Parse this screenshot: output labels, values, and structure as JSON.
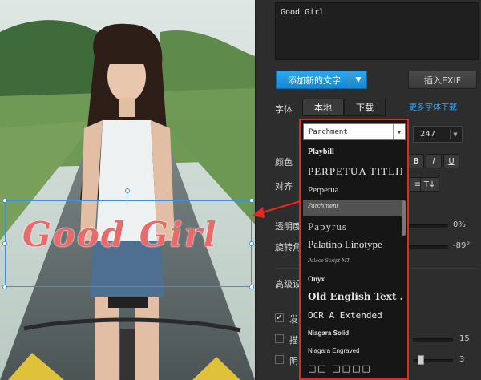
{
  "text_input": {
    "value": "Good Girl"
  },
  "buttons": {
    "add_text": "添加新的文字",
    "insert_exif": "插入EXIF"
  },
  "font": {
    "label": "字体",
    "tabs": [
      "本地",
      "下载"
    ],
    "more_link": "更多字体下载",
    "selected": "Parchment",
    "size": "247",
    "list": [
      "Playbill",
      "PERPETUA TITLIN...",
      "Perpetua",
      "Parchment",
      "Papyrus",
      "Palatino Linotype",
      "Palace Script MT",
      "Onyx",
      "Old English Text ...",
      "OCR A Extended",
      "Niagara Solid",
      "Niagara Engraved",
      "□□ □□□□"
    ]
  },
  "color": {
    "label": "颜色",
    "styles": [
      "B",
      "I",
      "U"
    ]
  },
  "align": {
    "label": "对齐",
    "vertical_icon": "T↓"
  },
  "opacity": {
    "label": "透明度",
    "value": "0%"
  },
  "rotation": {
    "label": "旋转角",
    "value": "-89°"
  },
  "advanced": {
    "label": "高级设"
  },
  "checks": [
    {
      "label": "发",
      "checked": true
    },
    {
      "label": "描",
      "value": "15"
    },
    {
      "label": "阴",
      "value": "3"
    }
  ],
  "overlay_text": "Good Girl",
  "colors": {
    "accent": "#1e90dc",
    "highlight_border": "#e02a22",
    "text_red": "#e96a6a",
    "link": "#3da3f0"
  },
  "icons": {
    "check": "check-icon",
    "dropdown": "chevron-down-icon",
    "pointer": "arrow-left-icon"
  }
}
